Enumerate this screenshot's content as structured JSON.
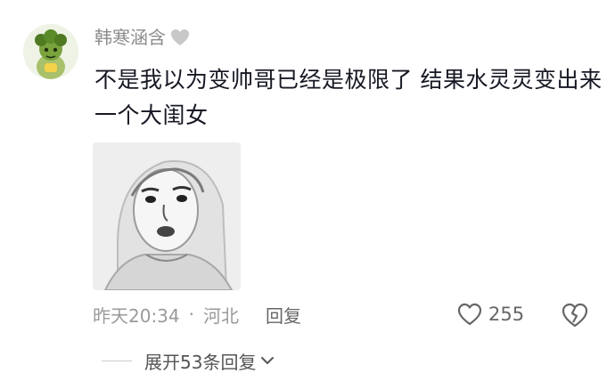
{
  "comment": {
    "username": "韩寒涵含",
    "badge_icon": "heart-icon",
    "text": "不是我以为变帅哥已经是极限了 结果水灵灵变出来一个大闺女",
    "image_icon": "sketch-face-sticker",
    "time": "昨天20:34",
    "separator": "·",
    "location": "河北",
    "reply_label": "回复",
    "like_count": "255",
    "expand_label": "展开53条回复"
  },
  "colors": {
    "meta_gray": "#9a9a9a",
    "text_dark": "#161823",
    "badge_gray": "#c8c8c8"
  }
}
